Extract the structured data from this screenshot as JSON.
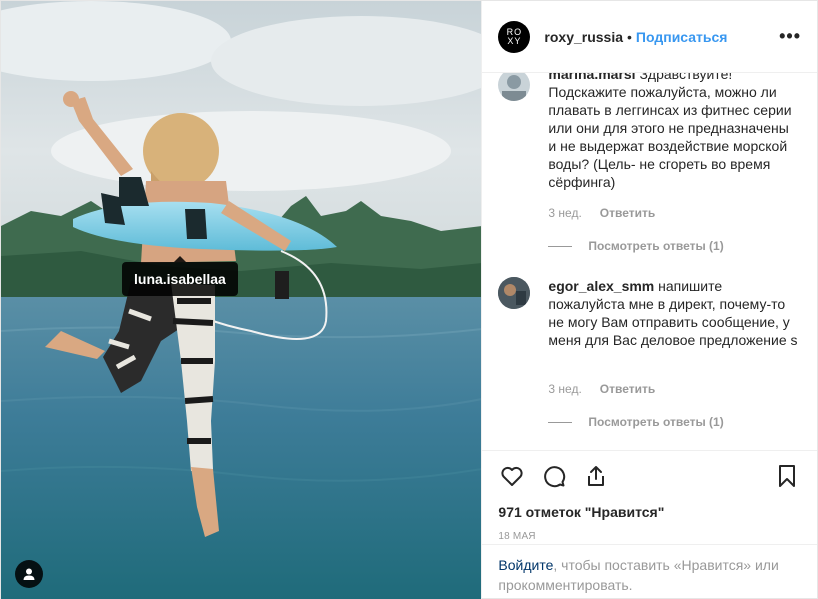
{
  "media": {
    "tagged_user": "luna.isabellaa",
    "user_tags_icon": "user-icon"
  },
  "header": {
    "logo_line1": "RO",
    "logo_line2": "XY",
    "username": "roxy_russia",
    "separator": "•",
    "follow": "Подписаться",
    "more": "•••"
  },
  "comments": [
    {
      "username": "marina.marsi",
      "text": "Здравствуйте! Подскажите пожалуйста, можно ли плавать в леггинсах из фитнес серии или они для этого не предназначены и не выдержат воздействие морской воды? (Цель- не сгореть во время сёрфинга)",
      "time": "3 нед.",
      "reply": "Ответить",
      "view_replies": "Посмотреть ответы (1)"
    },
    {
      "username": "egor_alex_smm",
      "text": "напишите пожалуйста мне в директ, почему-то не могу Вам отправить сообщение, у меня для Вас деловое предложение s",
      "time": "3 нед.",
      "reply": "Ответить",
      "view_replies": "Посмотреть ответы (1)"
    }
  ],
  "actions": {
    "like_icon": "heart-icon",
    "comment_icon": "comment-icon",
    "share_icon": "share-icon",
    "save_icon": "bookmark-icon"
  },
  "likes": "971 отметок \"Нравится\"",
  "date": "18 мая",
  "login": {
    "link": "Войдите",
    "text": ", чтобы поставить «Нравится» или прокомментировать."
  },
  "colors": {
    "accent": "#3897f0",
    "link_dark": "#003569",
    "muted": "#999999"
  }
}
